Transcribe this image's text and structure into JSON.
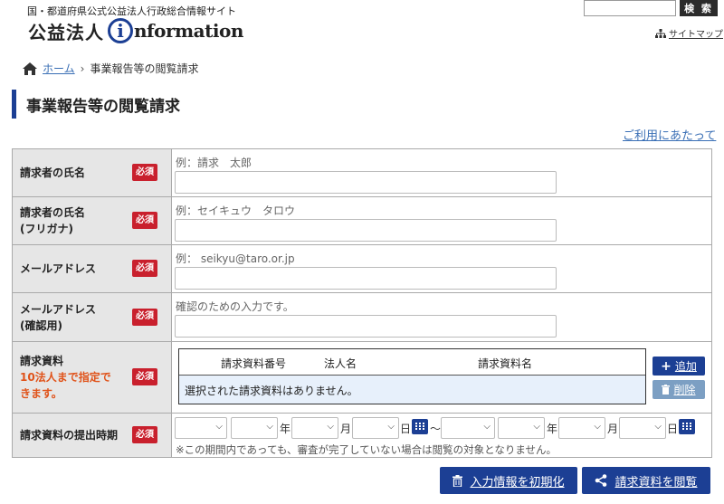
{
  "header": {
    "subtitle": "国・都道府県公式公益法人行政総合情報サイト",
    "logo_jp": "公益法人",
    "logo_i": "i",
    "logo_en": "nformation",
    "search_button": "検 索",
    "sitemap": "サイトマップ"
  },
  "breadcrumb": {
    "home": "ホーム",
    "separator": "›",
    "current": "事業報告等の閲覧請求"
  },
  "page_title": "事業報告等の閲覧請求",
  "guide_link": "ご利用にあたって",
  "required_badge": "必須",
  "form": {
    "name": {
      "label": "請求者の氏名",
      "hint": "例：請求　太郎"
    },
    "kana": {
      "label1": "請求者の氏名",
      "label2": "(フリガナ)",
      "hint": "例：セイキュウ　タロウ"
    },
    "email": {
      "label": "メールアドレス",
      "hint": "例： seikyu@taro.or.jp"
    },
    "email_confirm": {
      "label1": "メールアドレス",
      "label2": "(確認用)",
      "hint": "確認のための入力です。"
    },
    "materials": {
      "label": "請求資料",
      "note1": "10法人まで指定で",
      "note2": "きます。",
      "columns": [
        "請求資料番号",
        "法人名",
        "請求資料名"
      ],
      "empty_message": "選択された請求資料はありません。",
      "add_button": "追加",
      "delete_button": "削除"
    },
    "period": {
      "label": "請求資料の提出時期",
      "year": "年",
      "month": "月",
      "day": "日",
      "tilde": "〜",
      "note": "※この期間内であっても、審査が完了していない場合は閲覧の対象となりません。"
    }
  },
  "buttons": {
    "reset": "入力情報を初期化",
    "view": "請求資料を閲覧"
  },
  "colors": {
    "accent": "#1c3f94",
    "required": "#c9202d",
    "note": "#e0531a",
    "link": "#3a6fb5"
  }
}
